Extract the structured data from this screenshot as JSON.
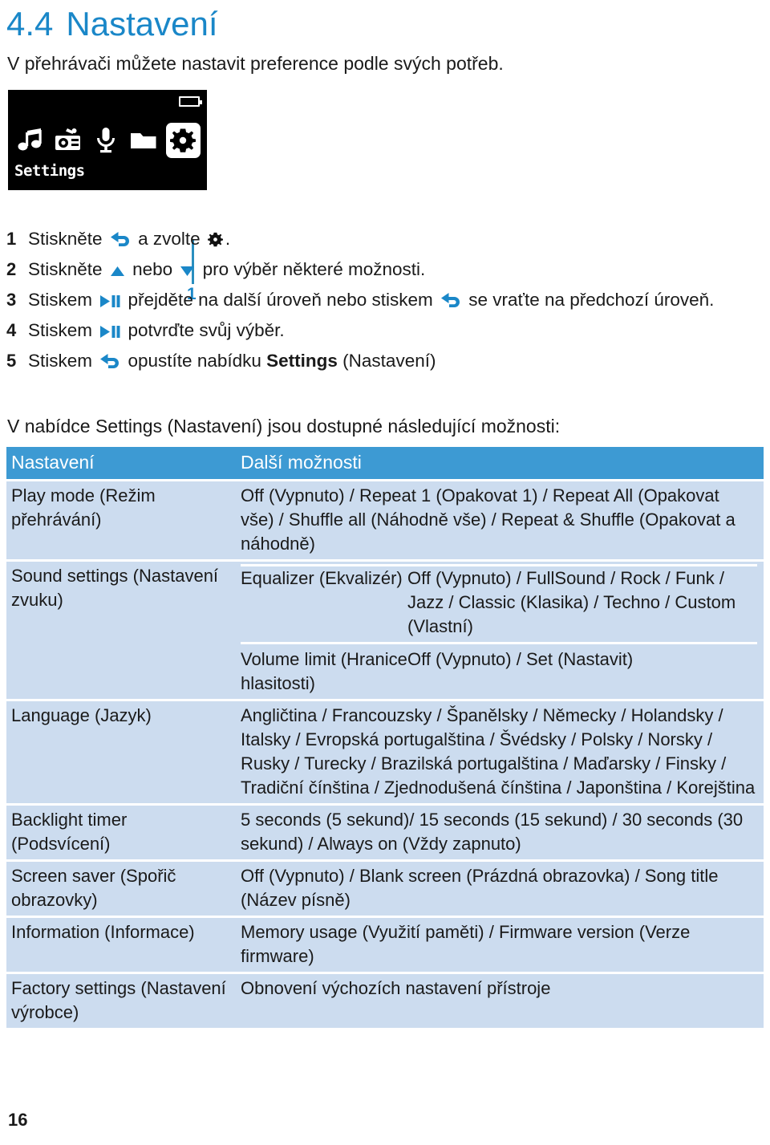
{
  "heading": {
    "number": "4.4",
    "title": "Nastavení"
  },
  "intro": "V přehrávači můžete nastavit preference podle svých potřeb.",
  "device_screen": {
    "label": "Settings",
    "icons": [
      "music-note-icon",
      "radio-icon",
      "microphone-icon",
      "folder-icon",
      "gear-icon"
    ],
    "selected_icon": "gear-icon",
    "battery_icon": "battery-icon",
    "callout_number": "1"
  },
  "steps": [
    {
      "number": "1",
      "parts": [
        {
          "type": "text",
          "value": "Stiskněte "
        },
        {
          "type": "icon",
          "value": "back-arrow-icon"
        },
        {
          "type": "text",
          "value": " a zvolte "
        },
        {
          "type": "icon",
          "value": "gear-icon"
        },
        {
          "type": "text",
          "value": "."
        }
      ]
    },
    {
      "number": "2",
      "parts": [
        {
          "type": "text",
          "value": "Stiskněte "
        },
        {
          "type": "icon",
          "value": "triangle-up-icon"
        },
        {
          "type": "text",
          "value": " nebo "
        },
        {
          "type": "icon",
          "value": "triangle-down-icon"
        },
        {
          "type": "text",
          "value": " pro výběr některé možnosti."
        }
      ]
    },
    {
      "number": "3",
      "parts": [
        {
          "type": "text",
          "value": "Stiskem "
        },
        {
          "type": "icon",
          "value": "play-pause-icon"
        },
        {
          "type": "text",
          "value": " přejděte na další úroveň nebo stiskem "
        },
        {
          "type": "icon",
          "value": "back-arrow-icon"
        },
        {
          "type": "text",
          "value": " se vraťte na předchozí úroveň."
        }
      ]
    },
    {
      "number": "4",
      "parts": [
        {
          "type": "text",
          "value": "Stiskem "
        },
        {
          "type": "icon",
          "value": "play-pause-icon"
        },
        {
          "type": "text",
          "value": " potvrďte svůj výběr."
        }
      ]
    },
    {
      "number": "5",
      "parts": [
        {
          "type": "text",
          "value": "Stiskem "
        },
        {
          "type": "icon",
          "value": "back-arrow-icon"
        },
        {
          "type": "text",
          "value": " opustíte nabídku "
        },
        {
          "type": "bold",
          "value": "Settings"
        },
        {
          "type": "text",
          "value": " (Nastavení)"
        }
      ]
    }
  ],
  "lead": "V nabídce Settings (Nastavení) jsou dostupné následující možnosti:",
  "table": {
    "headers": [
      "Nastavení",
      "Další možnosti"
    ],
    "rows": [
      {
        "setting": "Play mode (Režim přehrávání)",
        "options": "Off (Vypnuto) / Repeat 1 (Opakovat 1) / Repeat All (Opakovat vše) / Shuffle all (Náhodně vše) / Repeat & Shuffle (Opakovat a náhodně)"
      },
      {
        "setting": "Sound settings (Nastavení zvuku)",
        "sub_rows": [
          {
            "name": "Equalizer (Ekvalizér)",
            "options": "Off (Vypnuto) / FullSound / Rock / Funk / Jazz / Classic (Klasika) / Techno / Custom (Vlastní)"
          },
          {
            "name": "Volume limit (Hranice hlasitosti)",
            "options": "Off (Vypnuto) / Set (Nastavit)"
          }
        ]
      },
      {
        "setting": "Language (Jazyk)",
        "options": "Angličtina / Francouzsky / Španělsky / Německy / Holandsky / Italsky / Evropská portugalština / Švédsky / Polsky / Norsky / Rusky / Turecky / Brazilská portugalština / Maďarsky / Finsky / Tradiční čínština / Zjednodušená čínština / Japonština / Korejština"
      },
      {
        "setting": "Backlight timer (Podsvícení)",
        "options": "5 seconds (5 sekund)/ 15 seconds (15 sekund) / 30 seconds (30 sekund) / Always on (Vždy zapnuto)"
      },
      {
        "setting": "Screen saver (Spořič obrazovky)",
        "options": "Off (Vypnuto) / Blank screen (Prázdná obrazovka) / Song title (Název písně)"
      },
      {
        "setting": "Information (Informace)",
        "options": "Memory usage (Využití paměti) / Firmware version (Verze firmware)"
      },
      {
        "setting": "Factory settings (Nastavení výrobce)",
        "options": "Obnovení výchozích nastavení přístroje"
      }
    ]
  },
  "page_number": "16",
  "colors": {
    "heading_blue": "#1a87c8",
    "table_header_blue": "#3d9ad3",
    "table_row_blue": "#ccdcef",
    "icon_blue": "#1a87c8",
    "callout_blue": "#2a8fbf"
  }
}
